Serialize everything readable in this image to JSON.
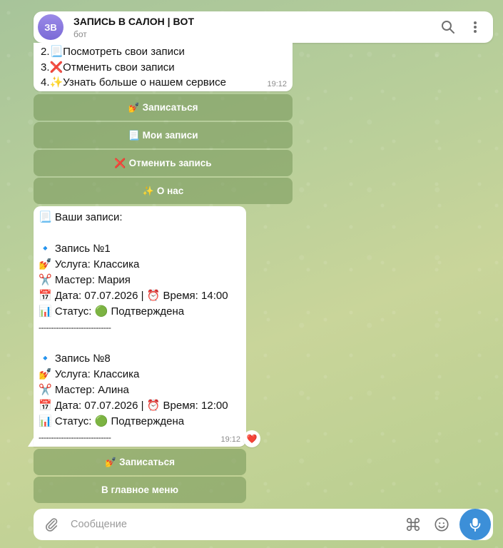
{
  "header": {
    "avatar_initials": "ЗВ",
    "title": "ЗАПИСЬ В САЛОН | BOT",
    "subtitle": "бот",
    "search_icon": "search-icon",
    "menu_icon": "more-vertical-icon"
  },
  "menu_message": {
    "lines": [
      "2.📃Посмотреть свои записи",
      "3.❌Отменить свои записи",
      "4.✨Узнать больше о нашем сервисе"
    ],
    "time": "19:12"
  },
  "keyboard_top": [
    {
      "emoji": "💅",
      "label": "Записаться"
    },
    {
      "emoji": "📃",
      "label": "Мои записи"
    },
    {
      "emoji": "❌",
      "label": "Отменить запись"
    },
    {
      "emoji": "✨",
      "label": "О нас"
    }
  ],
  "records_message": {
    "heading": "📃 Ваши записи:",
    "records": [
      {
        "title": "🔹 Запись №1",
        "service": "💅 Услуга: Классика",
        "master": "✂️ Мастер: Мария",
        "datetime": "📅 Дата: 07.07.2026 | ⏰ Время: 14:00",
        "status": "📊 Статус: 🟢 Подтверждена",
        "separator": "-----------------------------"
      },
      {
        "title": "🔹 Запись №8",
        "service": "💅 Услуга: Классика",
        "master": "✂️ Мастер: Алина",
        "datetime": "📅 Дата: 07.07.2026 | ⏰ Время: 12:00",
        "status": "📊 Статус: 🟢 Подтверждена",
        "separator": "-----------------------------"
      }
    ],
    "time": "19:12",
    "reaction": "❤️"
  },
  "keyboard_bottom": [
    {
      "emoji": "💅",
      "label": "Записаться"
    },
    {
      "emoji": "",
      "label": "В главное меню"
    }
  ],
  "composer": {
    "placeholder": "Сообщение",
    "attach_icon": "paperclip-icon",
    "commands_icon": "command-icon",
    "emoji_icon": "smile-icon",
    "mic_icon": "microphone-icon"
  },
  "colors": {
    "accent": "#3c8fd8",
    "avatar": "#8a7ae0",
    "keyboard_button": "#7a9a5c"
  }
}
